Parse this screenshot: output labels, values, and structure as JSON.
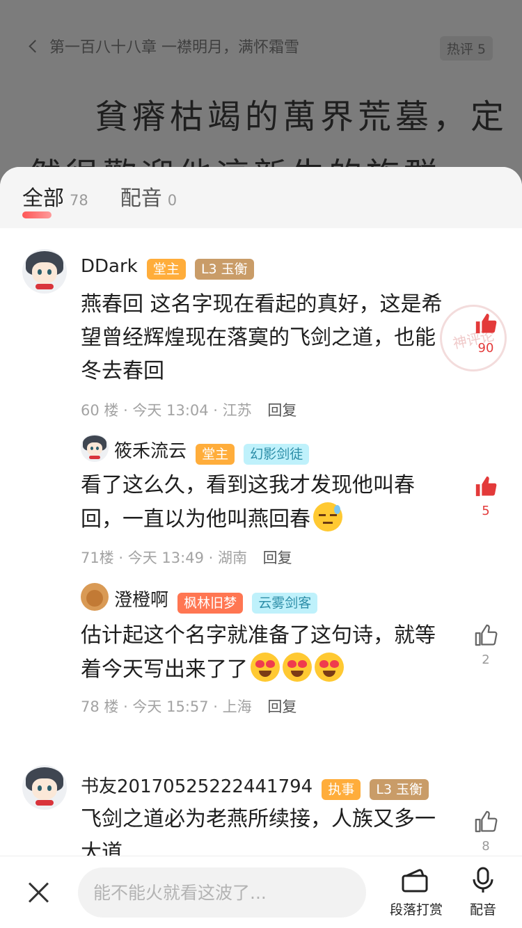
{
  "reader": {
    "chapter_title": "第一百八十八章 一襟明月，满怀霜雪",
    "hot_label": "热评 5",
    "line1": "貧瘠枯竭的萬界荒墓，定",
    "line2": "然很歡迎他這新生的族群，"
  },
  "tabs": [
    {
      "label": "全部",
      "count": "78",
      "active": true
    },
    {
      "label": "配音",
      "count": "0",
      "active": false
    }
  ],
  "stamp_text": "神评论",
  "comments": [
    {
      "user": "DDark",
      "badges": [
        "堂主",
        "L3 玉衡"
      ],
      "body": "燕春回 这名字现在看起的真好，这是希望曾经辉煌现在落寞的飞剑之道，也能冬去春回",
      "meta": "60 楼 · 今天 13:04 · 江苏",
      "reply": "回复",
      "likes": "90",
      "liked": true
    },
    {
      "user": "筱禾流云",
      "badges": [
        "堂主",
        "幻影剑徒"
      ],
      "body": "看了这么久，看到这我才发现他叫春回，一直以为他叫燕回春",
      "meta": "71楼 · 今天 13:49 · 湖南",
      "reply": "回复",
      "likes": "5",
      "liked": true
    },
    {
      "user": "澄橙啊",
      "badges": [
        "枫林旧梦",
        "云雾剑客"
      ],
      "body": "估计起这个名字就准备了这句诗，就等着今天写出来了了",
      "meta": "78 楼 · 今天 15:57 · 上海",
      "reply": "回复",
      "likes": "2",
      "liked": false
    },
    {
      "user": "书友20170525222441794",
      "badges": [
        "执事",
        "L3 玉衡"
      ],
      "body": "飞剑之道必为老燕所续接，人族又多一大道",
      "likes": "8",
      "liked": false
    }
  ],
  "bottom": {
    "input_placeholder": "能不能火就看这波了...",
    "tip_label": "段落打赏",
    "voice_label": "配音"
  },
  "colors": {
    "accent_red": "#e33a3a",
    "badge_orange": "#ffad3b",
    "badge_gold": "#c99c68"
  }
}
